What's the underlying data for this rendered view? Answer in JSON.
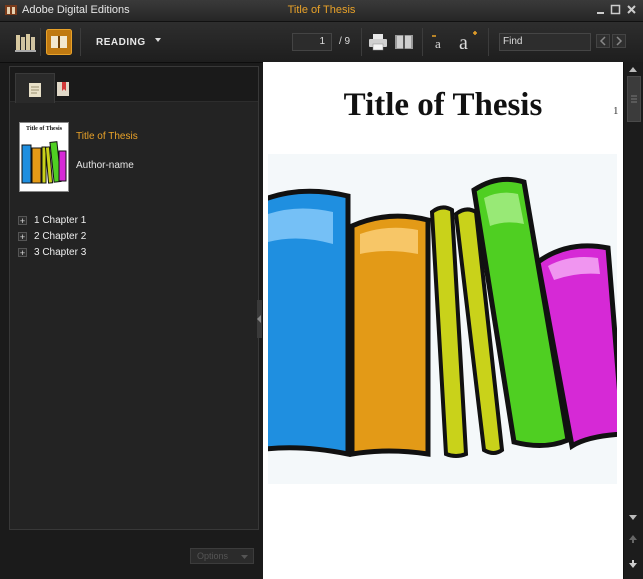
{
  "window": {
    "app_name": "Adobe Digital Editions",
    "document_title": "Title of Thesis"
  },
  "toolbar": {
    "view_mode": "READING",
    "current_page": "1",
    "total_pages": "/ 9",
    "find_placeholder": "Find"
  },
  "sidebar": {
    "book_title": "Title of Thesis",
    "author": "Author-name",
    "cover_caption": "Title of Thesis",
    "toc": [
      {
        "label": "1 Chapter 1"
      },
      {
        "label": "2 Chapter 2"
      },
      {
        "label": "3 Chapter 3"
      }
    ],
    "options_label": "Options"
  },
  "page": {
    "heading": "Title of Thesis",
    "page_number": "1"
  },
  "colors": {
    "accent": "#e9a229",
    "book_blue": "#1f8fe0",
    "book_orange": "#e39a17",
    "book_yellow": "#c9d21a",
    "book_green": "#4fcf22",
    "book_magenta": "#d629d6"
  }
}
